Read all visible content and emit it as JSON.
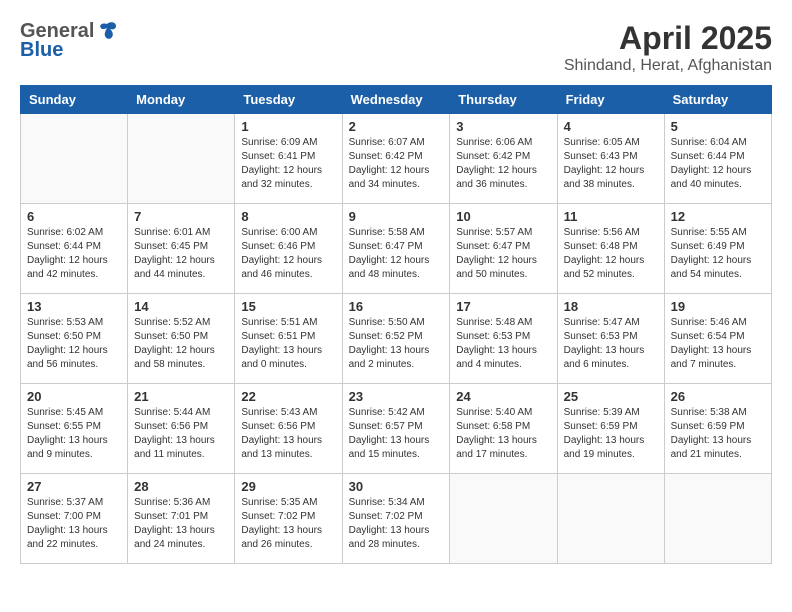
{
  "header": {
    "logo_general": "General",
    "logo_blue": "Blue",
    "month_title": "April 2025",
    "location": "Shindand, Herat, Afghanistan"
  },
  "days_of_week": [
    "Sunday",
    "Monday",
    "Tuesday",
    "Wednesday",
    "Thursday",
    "Friday",
    "Saturday"
  ],
  "weeks": [
    [
      {
        "day": "",
        "sunrise": "",
        "sunset": "",
        "daylight": ""
      },
      {
        "day": "",
        "sunrise": "",
        "sunset": "",
        "daylight": ""
      },
      {
        "day": "1",
        "sunrise": "Sunrise: 6:09 AM",
        "sunset": "Sunset: 6:41 PM",
        "daylight": "Daylight: 12 hours and 32 minutes."
      },
      {
        "day": "2",
        "sunrise": "Sunrise: 6:07 AM",
        "sunset": "Sunset: 6:42 PM",
        "daylight": "Daylight: 12 hours and 34 minutes."
      },
      {
        "day": "3",
        "sunrise": "Sunrise: 6:06 AM",
        "sunset": "Sunset: 6:42 PM",
        "daylight": "Daylight: 12 hours and 36 minutes."
      },
      {
        "day": "4",
        "sunrise": "Sunrise: 6:05 AM",
        "sunset": "Sunset: 6:43 PM",
        "daylight": "Daylight: 12 hours and 38 minutes."
      },
      {
        "day": "5",
        "sunrise": "Sunrise: 6:04 AM",
        "sunset": "Sunset: 6:44 PM",
        "daylight": "Daylight: 12 hours and 40 minutes."
      }
    ],
    [
      {
        "day": "6",
        "sunrise": "Sunrise: 6:02 AM",
        "sunset": "Sunset: 6:44 PM",
        "daylight": "Daylight: 12 hours and 42 minutes."
      },
      {
        "day": "7",
        "sunrise": "Sunrise: 6:01 AM",
        "sunset": "Sunset: 6:45 PM",
        "daylight": "Daylight: 12 hours and 44 minutes."
      },
      {
        "day": "8",
        "sunrise": "Sunrise: 6:00 AM",
        "sunset": "Sunset: 6:46 PM",
        "daylight": "Daylight: 12 hours and 46 minutes."
      },
      {
        "day": "9",
        "sunrise": "Sunrise: 5:58 AM",
        "sunset": "Sunset: 6:47 PM",
        "daylight": "Daylight: 12 hours and 48 minutes."
      },
      {
        "day": "10",
        "sunrise": "Sunrise: 5:57 AM",
        "sunset": "Sunset: 6:47 PM",
        "daylight": "Daylight: 12 hours and 50 minutes."
      },
      {
        "day": "11",
        "sunrise": "Sunrise: 5:56 AM",
        "sunset": "Sunset: 6:48 PM",
        "daylight": "Daylight: 12 hours and 52 minutes."
      },
      {
        "day": "12",
        "sunrise": "Sunrise: 5:55 AM",
        "sunset": "Sunset: 6:49 PM",
        "daylight": "Daylight: 12 hours and 54 minutes."
      }
    ],
    [
      {
        "day": "13",
        "sunrise": "Sunrise: 5:53 AM",
        "sunset": "Sunset: 6:50 PM",
        "daylight": "Daylight: 12 hours and 56 minutes."
      },
      {
        "day": "14",
        "sunrise": "Sunrise: 5:52 AM",
        "sunset": "Sunset: 6:50 PM",
        "daylight": "Daylight: 12 hours and 58 minutes."
      },
      {
        "day": "15",
        "sunrise": "Sunrise: 5:51 AM",
        "sunset": "Sunset: 6:51 PM",
        "daylight": "Daylight: 13 hours and 0 minutes."
      },
      {
        "day": "16",
        "sunrise": "Sunrise: 5:50 AM",
        "sunset": "Sunset: 6:52 PM",
        "daylight": "Daylight: 13 hours and 2 minutes."
      },
      {
        "day": "17",
        "sunrise": "Sunrise: 5:48 AM",
        "sunset": "Sunset: 6:53 PM",
        "daylight": "Daylight: 13 hours and 4 minutes."
      },
      {
        "day": "18",
        "sunrise": "Sunrise: 5:47 AM",
        "sunset": "Sunset: 6:53 PM",
        "daylight": "Daylight: 13 hours and 6 minutes."
      },
      {
        "day": "19",
        "sunrise": "Sunrise: 5:46 AM",
        "sunset": "Sunset: 6:54 PM",
        "daylight": "Daylight: 13 hours and 7 minutes."
      }
    ],
    [
      {
        "day": "20",
        "sunrise": "Sunrise: 5:45 AM",
        "sunset": "Sunset: 6:55 PM",
        "daylight": "Daylight: 13 hours and 9 minutes."
      },
      {
        "day": "21",
        "sunrise": "Sunrise: 5:44 AM",
        "sunset": "Sunset: 6:56 PM",
        "daylight": "Daylight: 13 hours and 11 minutes."
      },
      {
        "day": "22",
        "sunrise": "Sunrise: 5:43 AM",
        "sunset": "Sunset: 6:56 PM",
        "daylight": "Daylight: 13 hours and 13 minutes."
      },
      {
        "day": "23",
        "sunrise": "Sunrise: 5:42 AM",
        "sunset": "Sunset: 6:57 PM",
        "daylight": "Daylight: 13 hours and 15 minutes."
      },
      {
        "day": "24",
        "sunrise": "Sunrise: 5:40 AM",
        "sunset": "Sunset: 6:58 PM",
        "daylight": "Daylight: 13 hours and 17 minutes."
      },
      {
        "day": "25",
        "sunrise": "Sunrise: 5:39 AM",
        "sunset": "Sunset: 6:59 PM",
        "daylight": "Daylight: 13 hours and 19 minutes."
      },
      {
        "day": "26",
        "sunrise": "Sunrise: 5:38 AM",
        "sunset": "Sunset: 6:59 PM",
        "daylight": "Daylight: 13 hours and 21 minutes."
      }
    ],
    [
      {
        "day": "27",
        "sunrise": "Sunrise: 5:37 AM",
        "sunset": "Sunset: 7:00 PM",
        "daylight": "Daylight: 13 hours and 22 minutes."
      },
      {
        "day": "28",
        "sunrise": "Sunrise: 5:36 AM",
        "sunset": "Sunset: 7:01 PM",
        "daylight": "Daylight: 13 hours and 24 minutes."
      },
      {
        "day": "29",
        "sunrise": "Sunrise: 5:35 AM",
        "sunset": "Sunset: 7:02 PM",
        "daylight": "Daylight: 13 hours and 26 minutes."
      },
      {
        "day": "30",
        "sunrise": "Sunrise: 5:34 AM",
        "sunset": "Sunset: 7:02 PM",
        "daylight": "Daylight: 13 hours and 28 minutes."
      },
      {
        "day": "",
        "sunrise": "",
        "sunset": "",
        "daylight": ""
      },
      {
        "day": "",
        "sunrise": "",
        "sunset": "",
        "daylight": ""
      },
      {
        "day": "",
        "sunrise": "",
        "sunset": "",
        "daylight": ""
      }
    ]
  ]
}
